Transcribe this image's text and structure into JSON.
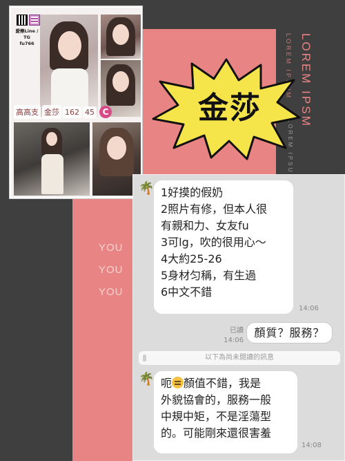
{
  "poster": {
    "lorem_big": "LOREM IPSM",
    "lorem_small": "LOREM IPSUM",
    "lorem_tiny": "LOREM IPSUM",
    "you_lines": [
      "YOU",
      "YOU",
      "YOU"
    ],
    "accent_color": "#e88584",
    "title": "金莎"
  },
  "collage": {
    "contact": "愛樂Line / TG\nfu766",
    "tags": [
      "高高支",
      "金莎",
      "162",
      "45"
    ],
    "cup": "C"
  },
  "chat": {
    "message_1": [
      "1好摸的假奶",
      "2照片有修，但本人很",
      "有親和力、女友fu",
      "3可lg，吹的很用心～",
      "4大約25-26",
      "5身材匀稱，有生過",
      "6中文不錯"
    ],
    "message_1_time": "14:06",
    "my_message": "顏質？服務？",
    "read_label": "已讀",
    "my_message_time": "14:06",
    "unread_divider": "以下為尚未閱讀的訊息",
    "message_2_prefix": "呃",
    "message_2_lines": [
      "顏值不錯，我是",
      "外貌協會的，服務一般",
      "中規中矩，不是淫蕩型",
      "的。可能剛來還很害羞"
    ],
    "message_2_time": "14:08",
    "avatar_icon": "palm-tree-icon"
  }
}
